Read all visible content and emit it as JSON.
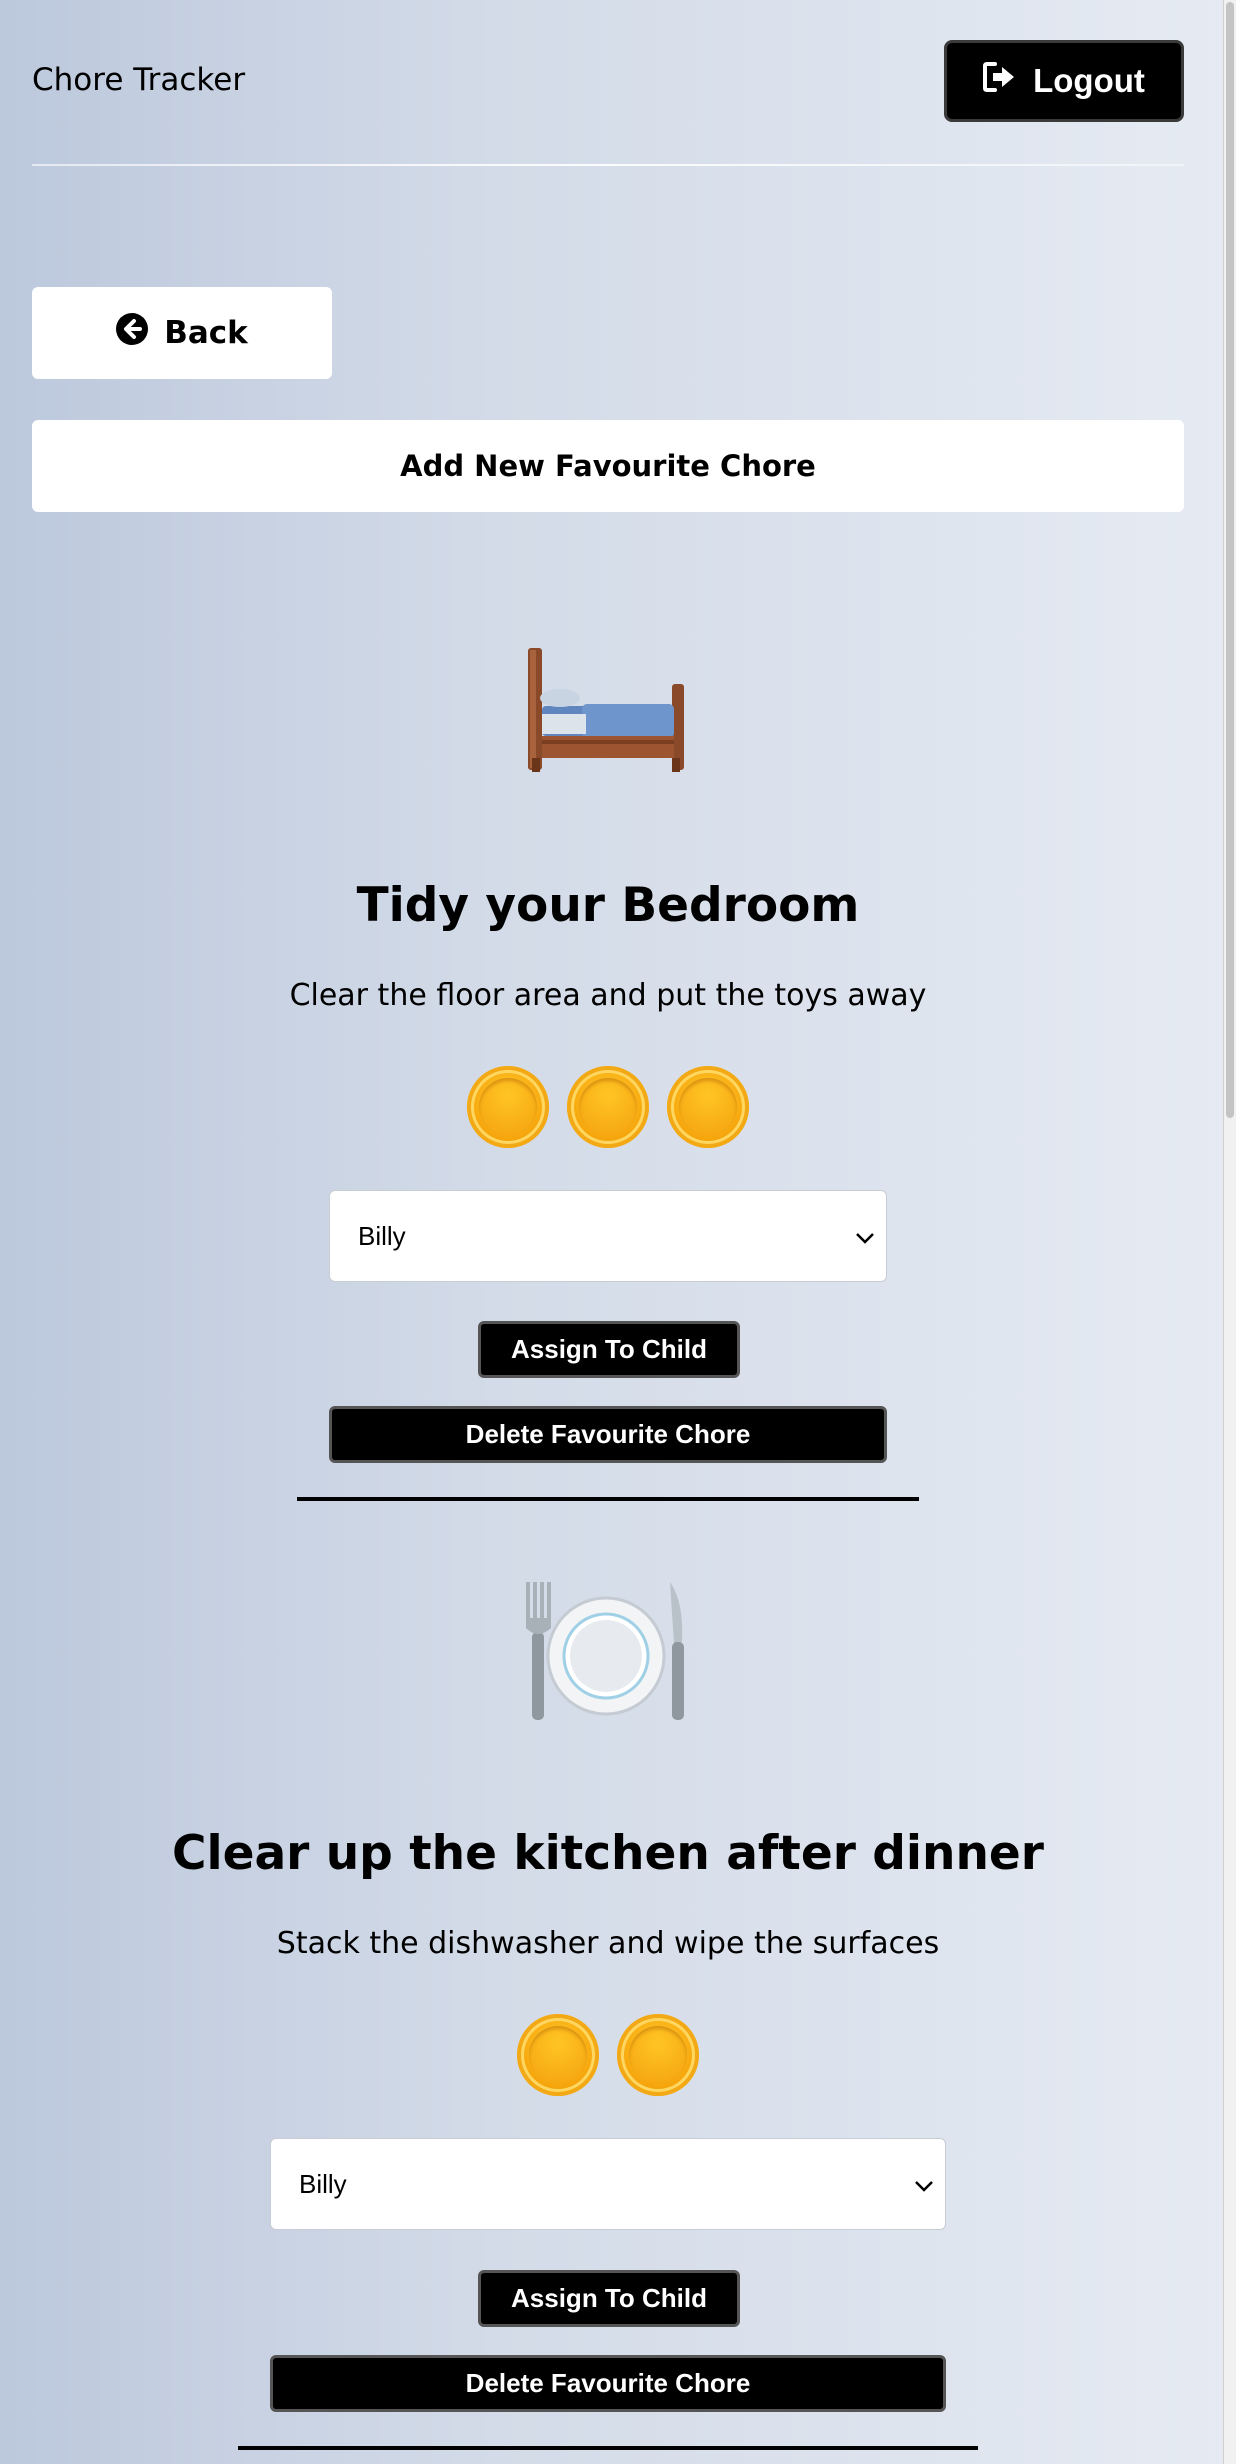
{
  "header": {
    "app_title": "Chore Tracker",
    "logout_label": "Logout"
  },
  "actions": {
    "back_label": "Back",
    "add_label": "Add New Favourite Chore"
  },
  "chores": [
    {
      "icon": "bed-icon",
      "title": "Tidy your Bedroom",
      "description": "Clear the floor area and put the toys away",
      "coins": 3,
      "selected_child": "Billy",
      "assign_label": "Assign To Child",
      "delete_label": "Delete Favourite Chore"
    },
    {
      "icon": "plate-cutlery-icon",
      "title": "Clear up the kitchen after dinner",
      "description": "Stack the dishwasher and wipe the surfaces",
      "coins": 2,
      "selected_child": "Billy",
      "assign_label": "Assign To Child",
      "delete_label": "Delete Favourite Chore"
    }
  ]
}
